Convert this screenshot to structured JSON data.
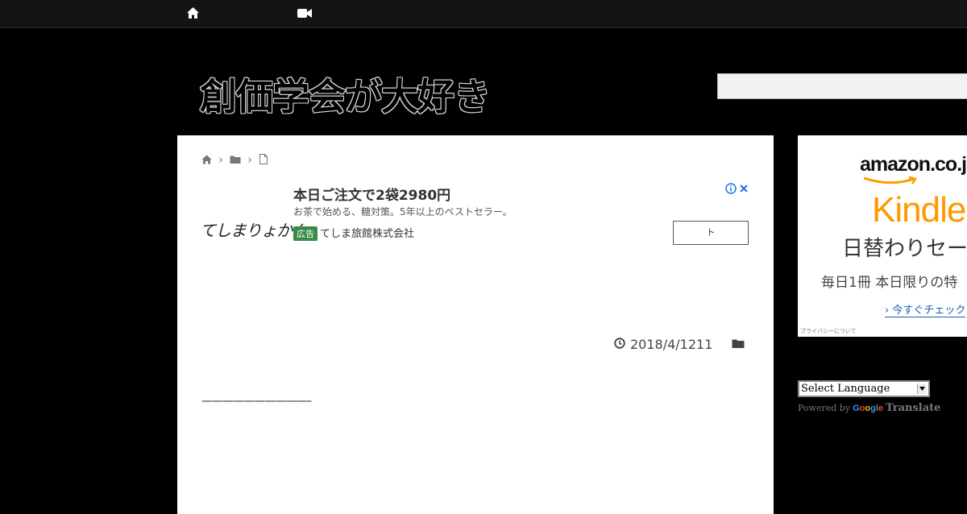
{
  "nav": {
    "home_icon": "home-icon",
    "video_icon": "video-camera-icon"
  },
  "site": {
    "title": "創価学会が大好き"
  },
  "search": {
    "placeholder": ""
  },
  "breadcrumb": {
    "home_icon": "home-icon",
    "category_icon": "folder-icon",
    "page_icon": "document-icon"
  },
  "ad": {
    "headline": "本日ご注文で2袋2980円",
    "description": "お茶で始める、糖対策。5年以上のベストセラー。",
    "badge": "広告",
    "advertiser": "てしま旅館株式会社",
    "cta": "ト",
    "logo_text": "てしまりょかん",
    "info_icon": "info-icon",
    "close_icon": "close-icon"
  },
  "post": {
    "date": "2018/4/1211",
    "clock_icon": "clock-icon",
    "category_icon": "folder-icon",
    "divider": "——————————–"
  },
  "sidebar_ad": {
    "brand": "amazon.co.jp",
    "product": "Kindle",
    "line1": "日替わりセー",
    "line2": "毎日1冊 本日限りの特",
    "cta": "› 今すぐチェック",
    "privacy": "プライバシーについて"
  },
  "translate": {
    "select_label": "Select Language",
    "powered_by": "Powered by",
    "google": "Google",
    "translate": "Translate"
  },
  "colors": {
    "kindle_orange": "#ff9900",
    "ad_badge": "#3a8a4a",
    "link_blue": "#1a5fb4"
  }
}
